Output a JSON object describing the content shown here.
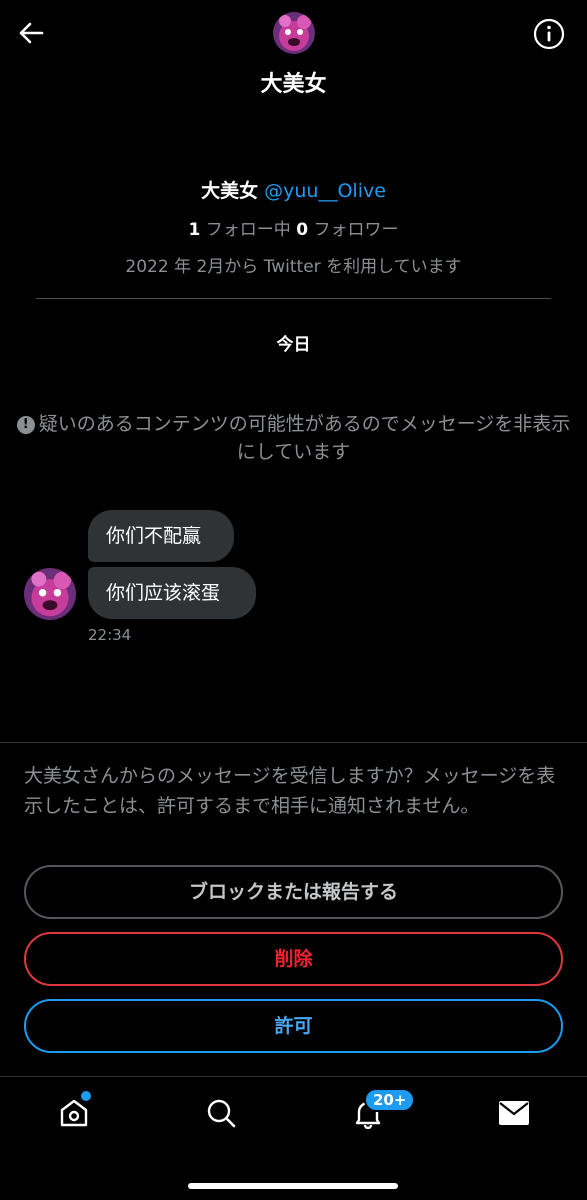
{
  "header": {
    "back_icon": "arrow-left-icon",
    "info_icon": "info-circle-icon",
    "title": "大美女"
  },
  "profile": {
    "name": "大美女",
    "handle": "@yuu__Olive",
    "following_count": "1",
    "following_label": "フォロー中",
    "followers_count": "0",
    "followers_label": "フォロワー",
    "joined": "2022 年 2月から Twitter を利用しています"
  },
  "conversation": {
    "date_separator": "今日",
    "hidden_notice": "疑いのあるコンテンツの可能性があるのでメッセージを非表示にしています",
    "messages": [
      {
        "text": "你们不配赢"
      },
      {
        "text": "你们应该滚蛋"
      }
    ],
    "time": "22:34"
  },
  "request": {
    "prompt": "大美女さんからのメッセージを受信しますか？メッセージを表示したことは、許可するまで相手に通知されません。",
    "block_label": "ブロックまたは報告する",
    "delete_label": "削除",
    "allow_label": "許可"
  },
  "tabbar": {
    "home_icon": "home-icon",
    "search_icon": "search-icon",
    "notifications_icon": "bell-icon",
    "notifications_badge": "20+",
    "messages_icon": "envelope-icon"
  },
  "colors": {
    "background": "#000000",
    "accent": "#1d9bf0",
    "danger": "#f4212e",
    "muted": "#8b8f94",
    "bubble": "#2f3336"
  }
}
